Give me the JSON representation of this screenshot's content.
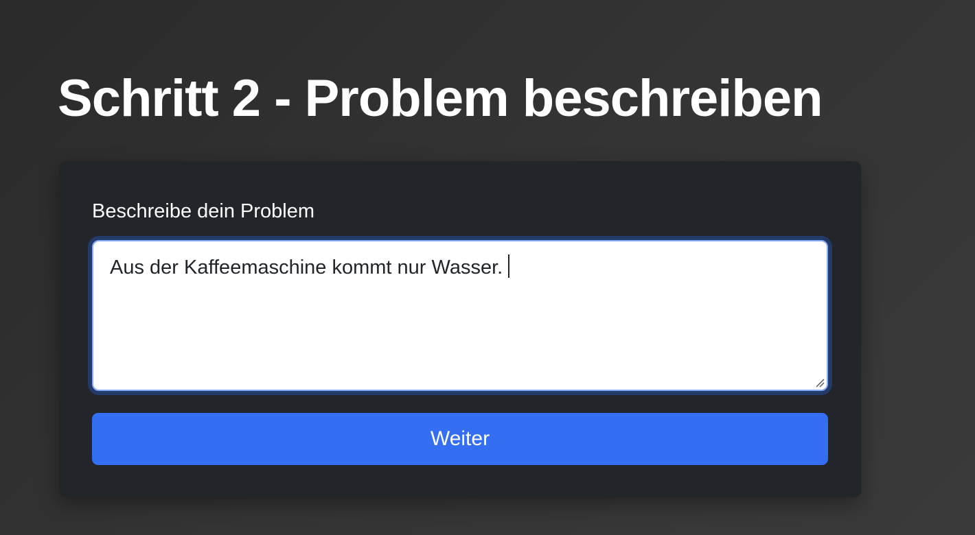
{
  "page": {
    "title": "Schritt 2 - Problem beschreiben"
  },
  "form": {
    "label": "Beschreibe dein Problem",
    "textarea_value": "Aus der Kaffeemaschine kommt nur Wasser.",
    "submit_label": "Weiter"
  },
  "colors": {
    "background": "#333333",
    "card": "#222529",
    "accent": "#346ff3",
    "focus_ring": "#86aef5"
  },
  "icons": {
    "resize_handle": "resize-grip-icon"
  }
}
